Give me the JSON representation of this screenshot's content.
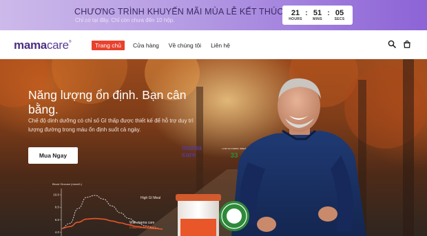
{
  "promo": {
    "title": "CHƯƠNG TRÌNH KHUYẾN MÃI MÙA LỄ KẾT THÚC SAU:",
    "subtitle": "Chỉ có tại đây. Chỉ còn chưa đến 10 hộp.",
    "countdown": {
      "hours": "21",
      "hours_label": "HOURS",
      "mins": "51",
      "mins_label": "MINS",
      "secs": "05",
      "secs_label": "SECS"
    }
  },
  "header": {
    "logo_bold": "mama",
    "logo_light": "care",
    "logo_mark": "®",
    "nav": [
      "Trang chủ",
      "Cửa hàng",
      "Về chúng tôi",
      "Liên hệ"
    ],
    "active_index": 0,
    "icons": [
      "search-icon",
      "shopping-bag-icon"
    ]
  },
  "hero": {
    "title": "Năng lượng ổn định. Bạn cân bằng.",
    "description": "Chế độ dinh dưỡng có chỉ số GI thấp được thiết kế để hỗ trợ duy trì lượng đường trong máu ổn định suốt cả ngày.",
    "cta_label": "Mua Ngay"
  },
  "product": {
    "label_line1": "mama",
    "label_line2": "care",
    "badge_number": "33",
    "badge_text": "LOW GLYCEMIC INDEX"
  },
  "chart_data": {
    "type": "line",
    "ylabel": "Blood Glucose (mmol/L)",
    "yticks": [
      10.0,
      8.0,
      6.0,
      4.0
    ],
    "ylim": [
      3.5,
      11
    ],
    "x": [
      0,
      1,
      2,
      3,
      4,
      5,
      6,
      7,
      8,
      9,
      10,
      11,
      12
    ],
    "series": [
      {
        "name": "High GI Meal",
        "values": [
          4.6,
          5.4,
          7.8,
          9.6,
          9.9,
          9.3,
          8.2,
          7.1,
          6.2,
          5.5,
          5.0,
          4.7,
          4.5
        ],
        "color": "#d9d9d9",
        "dashed": true
      },
      {
        "name": "With mama care Diabetic Nutrition",
        "values": [
          4.6,
          4.9,
          5.6,
          6.1,
          6.2,
          6.1,
          5.8,
          5.5,
          5.2,
          4.9,
          4.7,
          4.6,
          4.5
        ],
        "color": "#e8562a",
        "dashed": false
      }
    ],
    "series_labels": [
      "High GI Meal",
      "With mama care",
      "Diabetic Nutrition"
    ],
    "colors": {
      "high_gi": "#d9d9d9",
      "with_mamacare": "#e8562a",
      "label_highlight": "#e8562a"
    }
  },
  "colors": {
    "promo_start": "#cdb9ea",
    "promo_end": "#8d63d6",
    "brand": "#4b2f80",
    "active_nav": "#e8412c",
    "badge_green": "#2e8a3a"
  }
}
